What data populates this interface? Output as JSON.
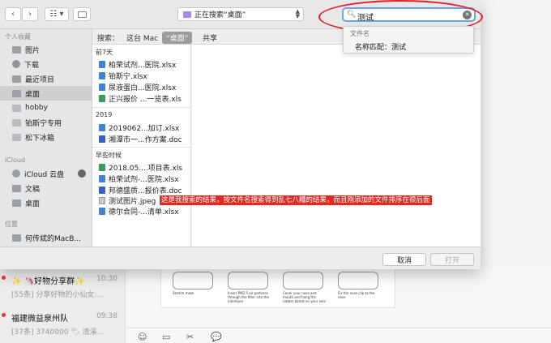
{
  "toolbar": {
    "back": "‹",
    "forward": "›",
    "view": "☷ ▾",
    "location": "正在搜索“桌面”",
    "search_value": "测试",
    "search_icon": "magnifier-icon",
    "clear_icon": "clear-search-icon"
  },
  "suggest": {
    "header": "文件名",
    "item": "名称匹配：测试"
  },
  "scope": {
    "label": "搜索：",
    "this_mac": "这台 Mac",
    "current": "“桌面”",
    "shared": "共享"
  },
  "sidebar": {
    "favorites_header": "个人收藏",
    "favorites": [
      "图片",
      "下载",
      "最近项目",
      "桌面",
      "hobby",
      "铂斯宁专用",
      "松下冰箱"
    ],
    "icloud_header": "iCloud",
    "icloud": [
      "iCloud 云盘",
      "文稿",
      "桌面"
    ],
    "locations_header": "位置",
    "locations": [
      "何传斌的MacB..."
    ]
  },
  "results": {
    "groups": [
      {
        "title": "前7天",
        "items": [
          {
            "name": "柏荣试剂...医院.xlsx",
            "type": "x"
          },
          {
            "name": "铂斯宁.xlsx",
            "type": "x"
          },
          {
            "name": "尿液蛋白...医院.xlsx",
            "type": "x"
          },
          {
            "name": "正兴报价 ...一览表.xls",
            "type": "d"
          }
        ]
      },
      {
        "title": "2019",
        "items": [
          {
            "name": "2019062...加订.xlsx",
            "type": "x"
          },
          {
            "name": "湘潭市一...作方案.doc",
            "type": "w"
          }
        ]
      },
      {
        "title": "早些时候",
        "items": [
          {
            "name": "2018.05....项目表.xls",
            "type": "d"
          },
          {
            "name": "柏荣试剂-...医院.xlsx",
            "type": "x"
          },
          {
            "name": "邦德盛质...报价表.doc",
            "type": "w"
          },
          {
            "name": "测试图片.jpeg",
            "type": "j"
          },
          {
            "name": "德尔合同-...清单.xlsx",
            "type": "x"
          }
        ]
      }
    ]
  },
  "annotation": {
    "note": "这是我搜索的结果，按文件名搜索得到乱七八糟的结果，而且刚添加的文件排序在很后面"
  },
  "buttons": {
    "cancel": "取消",
    "open": "打开"
  },
  "chat": {
    "items": [
      {
        "title": "✨ 🦄好物分享群✨",
        "time": "10:30",
        "sub": "[55条] 分享好物的小仙女:..."
      },
      {
        "title": "福建微益泉州队",
        "time": "09:38",
        "sub": "[37条] 3740000 🏷 清溪..."
      }
    ],
    "tools": [
      "☺",
      "▭",
      "✂",
      "💬"
    ],
    "preview_captions": [
      "Stretch mask",
      "Insert PM2.5 air particles through the filter into the interlayer",
      "Cover your nose and mouth and hang the rubber bands on your ears",
      "Fix the nose clip to the nose"
    ]
  },
  "colors": {
    "annotation_red": "#e0202a",
    "search_focus": "#6da3e6"
  }
}
